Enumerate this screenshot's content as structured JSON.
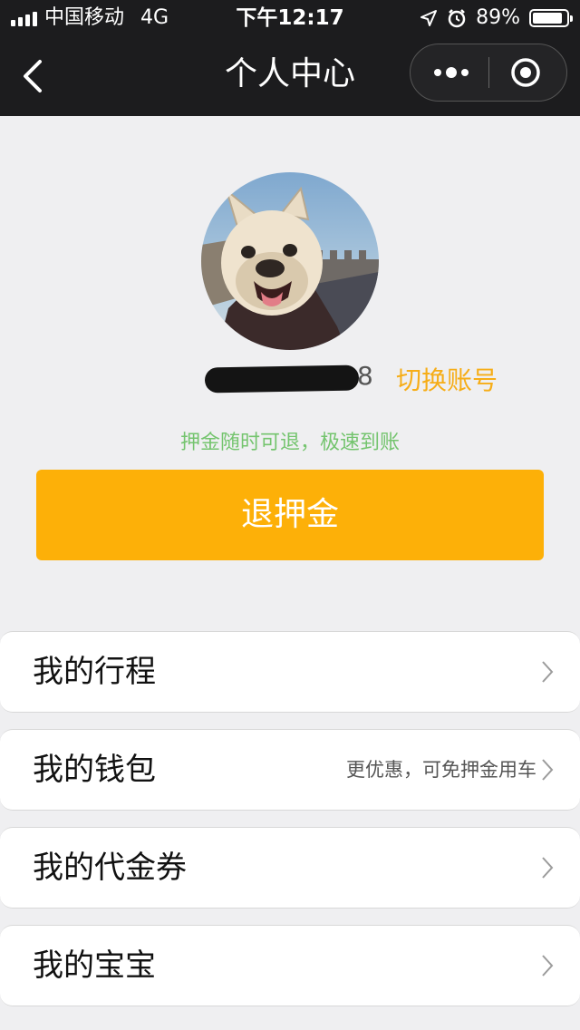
{
  "status_bar": {
    "carrier": "中国移动",
    "network": "4G",
    "time": "下午12:17",
    "battery_percent": "89%",
    "battery_level": 0.89
  },
  "nav": {
    "title": "个人中心"
  },
  "profile": {
    "username_visible_tail": "8",
    "switch_account": "切换账号"
  },
  "deposit": {
    "note": "押金随时可退，极速到账",
    "refund_button": "退押金"
  },
  "menu": {
    "items": [
      {
        "label": "我的行程",
        "hint": ""
      },
      {
        "label": "我的钱包",
        "hint": "更优惠，可免押金用车"
      },
      {
        "label": "我的代金券",
        "hint": ""
      },
      {
        "label": "我的宝宝",
        "hint": ""
      }
    ]
  },
  "colors": {
    "accent": "#fdb008",
    "switch_text": "#f6ad17",
    "note_green": "#74c46e",
    "topbar": "#1c1c1e",
    "background": "#efeff1"
  },
  "icons": {
    "back": "chevron-left-icon",
    "more": "more-dots-icon",
    "close": "target-circle-icon",
    "location": "location-arrow-icon",
    "alarm": "alarm-clock-icon",
    "menu_chevron": "chevron-right-icon"
  }
}
